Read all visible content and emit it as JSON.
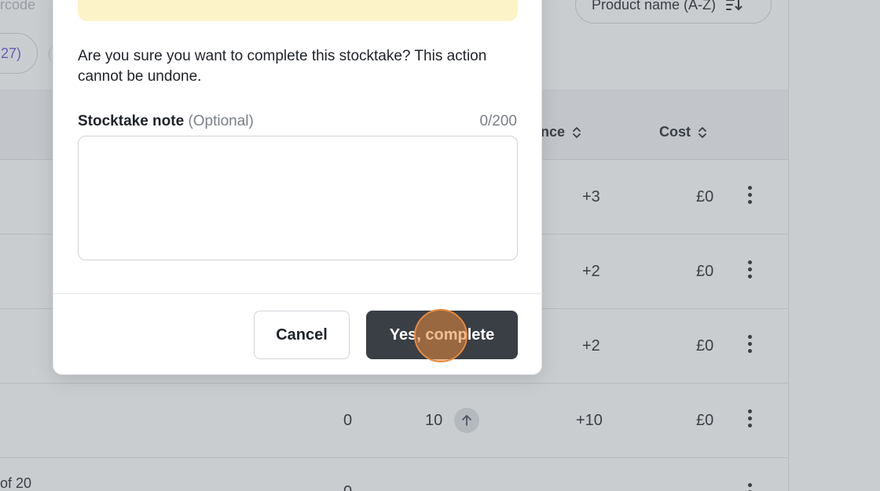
{
  "background": {
    "search_placeholder": "rcode",
    "sort_button_label": "Product name (A-Z)",
    "filter_chip_label": "27)",
    "columns": {
      "variance": "nce",
      "cost": "Cost"
    },
    "rows": [
      {
        "counted": "",
        "variance": "+3",
        "cost": "£0"
      },
      {
        "counted": "",
        "variance": "+2",
        "cost": "£0"
      },
      {
        "counted": "",
        "variance": "+2",
        "cost": "£0"
      },
      {
        "expected": "0",
        "counted": "10",
        "variance": "+10",
        "cost": "£0"
      }
    ],
    "pagination_text": "of 20",
    "partial_row_value": "0"
  },
  "modal": {
    "confirm_text": "Are you sure you want to complete this stocktake? This action cannot be undone.",
    "note_label": "Stocktake note",
    "note_optional": "(Optional)",
    "note_count": "0/200",
    "note_value": "",
    "cancel_label": "Cancel",
    "confirm_label": "Yes, complete"
  },
  "colors": {
    "primary_button": "#3a3f45",
    "warning_band": "#fdf3c8",
    "accent_chip_text": "#6b5bd2",
    "click_indicator": "#e8893c"
  }
}
